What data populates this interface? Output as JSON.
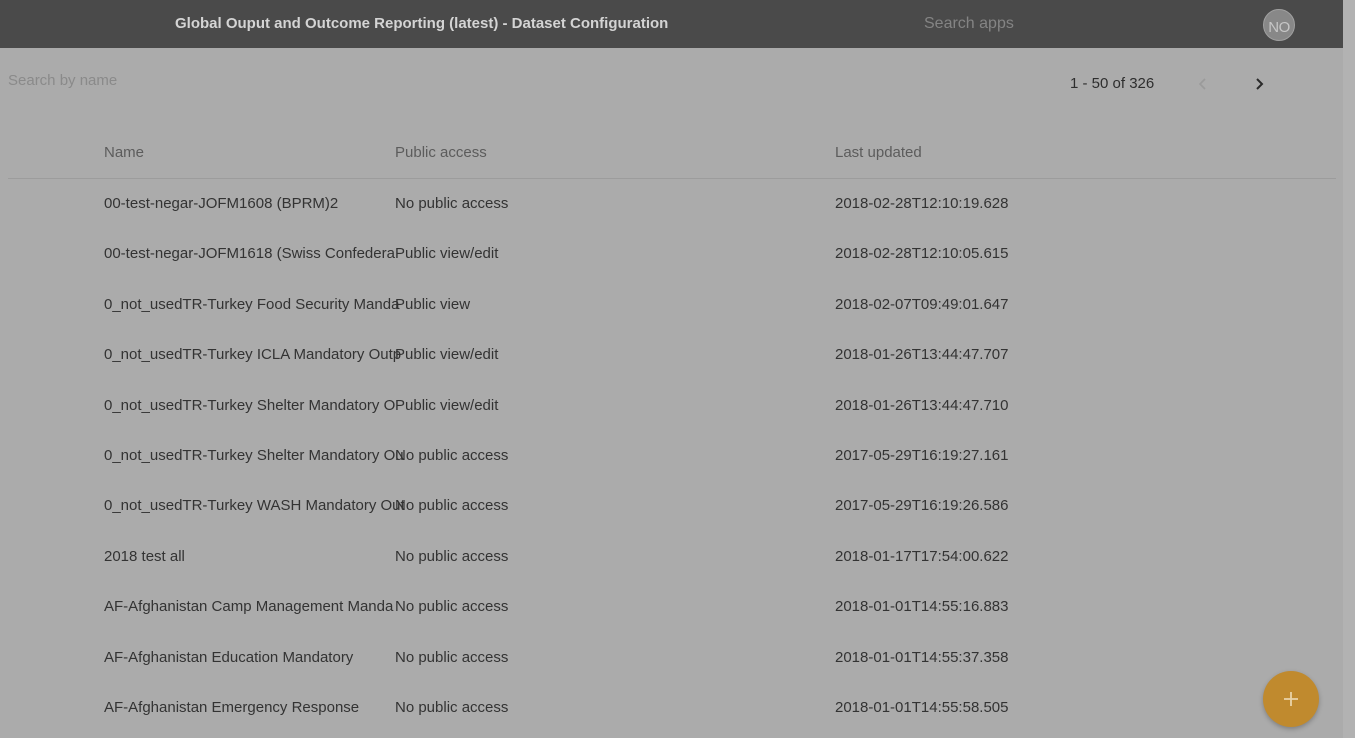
{
  "topbar": {
    "title": "Global Ouput and Outcome Reporting (latest) - Dataset Configuration",
    "search_placeholder": "Search apps",
    "avatar_initials": "NO"
  },
  "list": {
    "search_placeholder": "Search by name",
    "pager": {
      "range_text": "1 - 50 of 326",
      "prev_icon": "chevron-left-icon",
      "next_icon": "chevron-right-icon",
      "prev_enabled": false,
      "next_enabled": true
    },
    "columns": {
      "name": "Name",
      "public_access": "Public access",
      "last_updated": "Last updated"
    },
    "rows": [
      {
        "name": "00-test-negar-JOFM1608 (BPRM)2",
        "access": "No public access",
        "updated": "2018-02-28T12:10:19.628"
      },
      {
        "name": "00-test-negar-JOFM1618 (Swiss Confedera",
        "access": "Public view/edit",
        "updated": "2018-02-28T12:10:05.615"
      },
      {
        "name": "0_not_usedTR-Turkey Food Security Manda",
        "access": "Public view",
        "updated": "2018-02-07T09:49:01.647"
      },
      {
        "name": "0_not_usedTR-Turkey ICLA Mandatory Outp",
        "access": "Public view/edit",
        "updated": "2018-01-26T13:44:47.707"
      },
      {
        "name": "0_not_usedTR-Turkey Shelter Mandatory O",
        "access": "Public view/edit",
        "updated": "2018-01-26T13:44:47.710"
      },
      {
        "name": "0_not_usedTR-Turkey Shelter Mandatory Ou",
        "access": "No public access",
        "updated": "2017-05-29T16:19:27.161"
      },
      {
        "name": "0_not_usedTR-Turkey WASH Mandatory Out",
        "access": "No public access",
        "updated": "2017-05-29T16:19:26.586"
      },
      {
        "name": "2018 test all",
        "access": "No public access",
        "updated": "2018-01-17T17:54:00.622"
      },
      {
        "name": "AF-Afghanistan Camp Management Manda",
        "access": "No public access",
        "updated": "2018-01-01T14:55:16.883"
      },
      {
        "name": "AF-Afghanistan Education Mandatory",
        "access": "No public access",
        "updated": "2018-01-01T14:55:37.358"
      },
      {
        "name": "AF-Afghanistan Emergency Response",
        "access": "No public access",
        "updated": "2018-01-01T14:55:58.505"
      }
    ]
  },
  "fab": {
    "icon": "plus-icon",
    "color": "#c08a2e"
  },
  "colors": {
    "topbar": "#4a4a4a",
    "background": "#ababab",
    "accent": "#c08a2e"
  }
}
